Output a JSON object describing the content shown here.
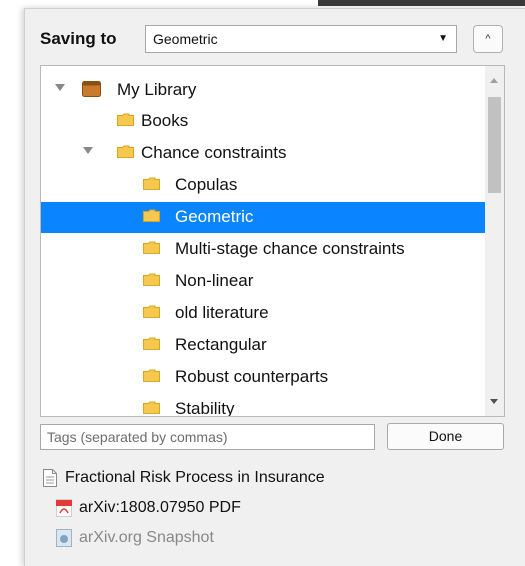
{
  "saving": {
    "label": "Saving to",
    "selected": "Geometric"
  },
  "tree": {
    "items": [
      {
        "label": "My Library",
        "kind": "library",
        "expanded": true
      },
      {
        "label": "Books",
        "kind": "folder"
      },
      {
        "label": "Chance constraints",
        "kind": "folder",
        "expanded": true
      },
      {
        "label": "Copulas",
        "kind": "folder"
      },
      {
        "label": "Geometric",
        "kind": "folder",
        "selected": true
      },
      {
        "label": "Multi-stage chance constraints",
        "kind": "folder"
      },
      {
        "label": "Non-linear",
        "kind": "folder"
      },
      {
        "label": "old literature",
        "kind": "folder"
      },
      {
        "label": "Rectangular",
        "kind": "folder"
      },
      {
        "label": "Robust counterparts",
        "kind": "folder"
      },
      {
        "label": "Stability",
        "kind": "folder"
      }
    ]
  },
  "tags": {
    "placeholder": "Tags (separated by commas)",
    "value": ""
  },
  "done_label": "Done",
  "items": {
    "main": "Fractional Risk Process in Insurance",
    "attachment_pdf": "arXiv:1808.07950 PDF",
    "attachment_snapshot": "arXiv.org Snapshot"
  },
  "colors": {
    "selection": "#0a84ff",
    "folder": "#f5c850",
    "pdf": "#e53935"
  }
}
